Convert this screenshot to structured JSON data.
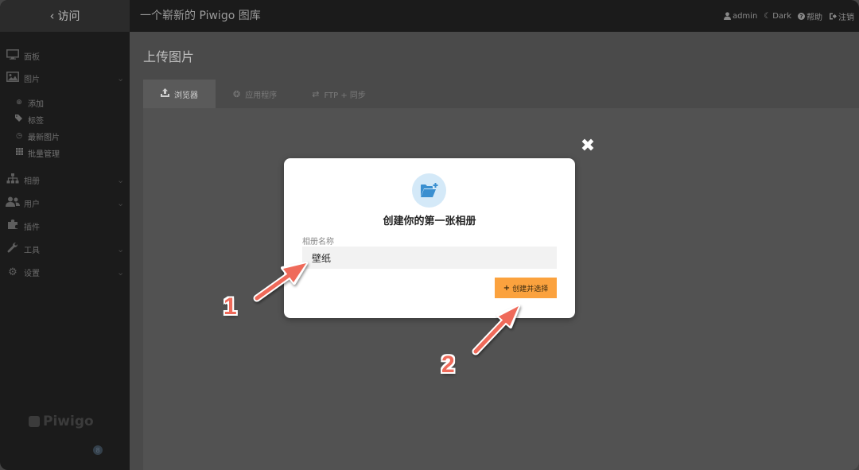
{
  "topbar": {
    "visit_label": "访问",
    "gallery_title": "一个崭新的 Piwigo 图库",
    "user": "admin",
    "theme": "Dark",
    "help": "帮助",
    "logout": "注销"
  },
  "sidebar": {
    "items": [
      {
        "label": "面板",
        "icon": "monitor-icon"
      },
      {
        "label": "图片",
        "icon": "image-icon"
      },
      {
        "label": "相册",
        "icon": "sitemap-icon"
      },
      {
        "label": "用户",
        "icon": "users-icon"
      },
      {
        "label": "插件",
        "icon": "puzzle-icon"
      },
      {
        "label": "工具",
        "icon": "wrench-icon"
      },
      {
        "label": "设置",
        "icon": "gear-icon"
      }
    ],
    "sub_items": [
      {
        "label": "添加",
        "icon": "plus-circle-icon"
      },
      {
        "label": "标签",
        "icon": "tags-icon"
      },
      {
        "label": "最新图片",
        "icon": "clock-icon"
      },
      {
        "label": "批量管理",
        "icon": "grid-icon"
      }
    ],
    "logo": "Piwigo",
    "logo_badge": "8"
  },
  "main": {
    "page_title": "上传图片",
    "tabs": [
      {
        "label": "浏览器",
        "icon": "upload-icon"
      },
      {
        "label": "应用程序",
        "icon": "gears-icon"
      },
      {
        "label": "FTP + 同步",
        "icon": "exchange-icon"
      }
    ]
  },
  "modal": {
    "title": "创建你的第一张相册",
    "field_label": "相册名称",
    "album_name": "壁纸",
    "create_button": "创建并选择"
  },
  "annotations": {
    "step1": "1",
    "step2": "2"
  },
  "colors": {
    "accent_orange": "#fba23e",
    "annotation_red": "#ef6a5a",
    "modal_icon_bg": "#d4e9f8",
    "modal_icon_fg": "#3a8fd0"
  }
}
